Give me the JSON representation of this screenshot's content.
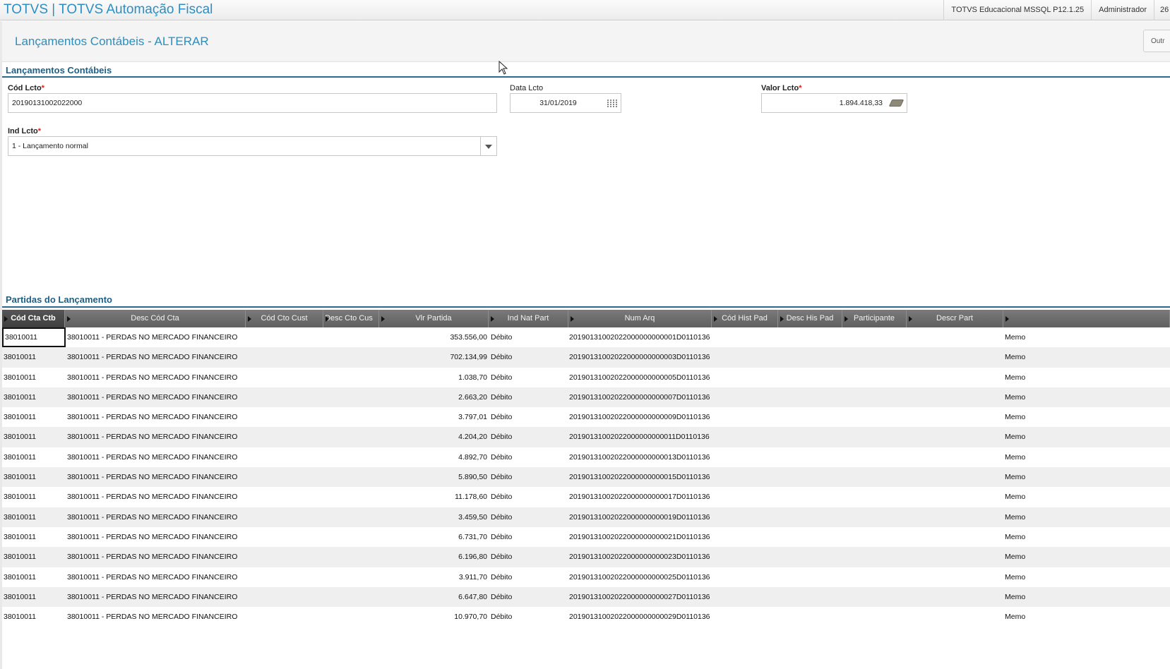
{
  "topbar": {
    "app_title": "TOTVS | TOTVS Automação Fiscal",
    "environment": "TOTVS Educacional MSSQL P12.1.25",
    "user": "Administrador",
    "date_fragment": "26"
  },
  "header": {
    "title": "Lançamentos Contábeis - ALTERAR",
    "other_actions_label": "Outr"
  },
  "section1": {
    "title": "Lançamentos Contábeis"
  },
  "form": {
    "cod_lcto": {
      "label": "Cód Lcto",
      "value": "20190131002022000",
      "required": "*"
    },
    "data_lcto": {
      "label": "Data Lcto",
      "value": "31/01/2019"
    },
    "valor_lcto": {
      "label": "Valor Lcto",
      "value": "1.894.418,33",
      "required": "*"
    },
    "ind_lcto": {
      "label": "Ind Lcto",
      "value": "1 - Lançamento normal",
      "required": "*"
    }
  },
  "section2": {
    "title": "Partidas do Lançamento"
  },
  "grid": {
    "columns": [
      "Cód Cta Ctb",
      "Desc Cód Cta",
      "Cód Cto Cust",
      "Desc Cto Cus",
      "Vlr Partida",
      "Ind Nat Part",
      "Num Arq",
      "Cód Hist Pad",
      "Desc His Pad",
      "Participante",
      "Descr Part",
      ""
    ],
    "rows": [
      {
        "cta": "38010011",
        "desc": "38010011 - PERDAS NO MERCADO FINANCEIRO",
        "vlr": "353.556,00",
        "nat": "Débito",
        "arq": "20190131002022000000000001D0110136",
        "part": "Memo"
      },
      {
        "cta": "38010011",
        "desc": "38010011 - PERDAS NO MERCADO FINANCEIRO",
        "vlr": "702.134,99",
        "nat": "Débito",
        "arq": "20190131002022000000000003D0110136",
        "part": "Memo"
      },
      {
        "cta": "38010011",
        "desc": "38010011 - PERDAS NO MERCADO FINANCEIRO",
        "vlr": "1.038,70",
        "nat": "Débito",
        "arq": "20190131002022000000000005D0110136",
        "part": "Memo"
      },
      {
        "cta": "38010011",
        "desc": "38010011 - PERDAS NO MERCADO FINANCEIRO",
        "vlr": "2.663,20",
        "nat": "Débito",
        "arq": "20190131002022000000000007D0110136",
        "part": "Memo"
      },
      {
        "cta": "38010011",
        "desc": "38010011 - PERDAS NO MERCADO FINANCEIRO",
        "vlr": "3.797,01",
        "nat": "Débito",
        "arq": "20190131002022000000000009D0110136",
        "part": "Memo"
      },
      {
        "cta": "38010011",
        "desc": "38010011 - PERDAS NO MERCADO FINANCEIRO",
        "vlr": "4.204,20",
        "nat": "Débito",
        "arq": "20190131002022000000000011D0110136",
        "part": "Memo"
      },
      {
        "cta": "38010011",
        "desc": "38010011 - PERDAS NO MERCADO FINANCEIRO",
        "vlr": "4.892,70",
        "nat": "Débito",
        "arq": "20190131002022000000000013D0110136",
        "part": "Memo"
      },
      {
        "cta": "38010011",
        "desc": "38010011 - PERDAS NO MERCADO FINANCEIRO",
        "vlr": "5.890,50",
        "nat": "Débito",
        "arq": "20190131002022000000000015D0110136",
        "part": "Memo"
      },
      {
        "cta": "38010011",
        "desc": "38010011 - PERDAS NO MERCADO FINANCEIRO",
        "vlr": "11.178,60",
        "nat": "Débito",
        "arq": "20190131002022000000000017D0110136",
        "part": "Memo"
      },
      {
        "cta": "38010011",
        "desc": "38010011 - PERDAS NO MERCADO FINANCEIRO",
        "vlr": "3.459,50",
        "nat": "Débito",
        "arq": "20190131002022000000000019D0110136",
        "part": "Memo"
      },
      {
        "cta": "38010011",
        "desc": "38010011 - PERDAS NO MERCADO FINANCEIRO",
        "vlr": "6.731,70",
        "nat": "Débito",
        "arq": "20190131002022000000000021D0110136",
        "part": "Memo"
      },
      {
        "cta": "38010011",
        "desc": "38010011 - PERDAS NO MERCADO FINANCEIRO",
        "vlr": "6.196,80",
        "nat": "Débito",
        "arq": "20190131002022000000000023D0110136",
        "part": "Memo"
      },
      {
        "cta": "38010011",
        "desc": "38010011 - PERDAS NO MERCADO FINANCEIRO",
        "vlr": "3.911,70",
        "nat": "Débito",
        "arq": "20190131002022000000000025D0110136",
        "part": "Memo"
      },
      {
        "cta": "38010011",
        "desc": "38010011 - PERDAS NO MERCADO FINANCEIRO",
        "vlr": "6.647,80",
        "nat": "Débito",
        "arq": "20190131002022000000000027D0110136",
        "part": "Memo"
      },
      {
        "cta": "38010011",
        "desc": "38010011 - PERDAS NO MERCADO FINANCEIRO",
        "vlr": "10.970,70",
        "nat": "Débito",
        "arq": "20190131002022000000000029D0110136",
        "part": "Memo"
      }
    ]
  }
}
